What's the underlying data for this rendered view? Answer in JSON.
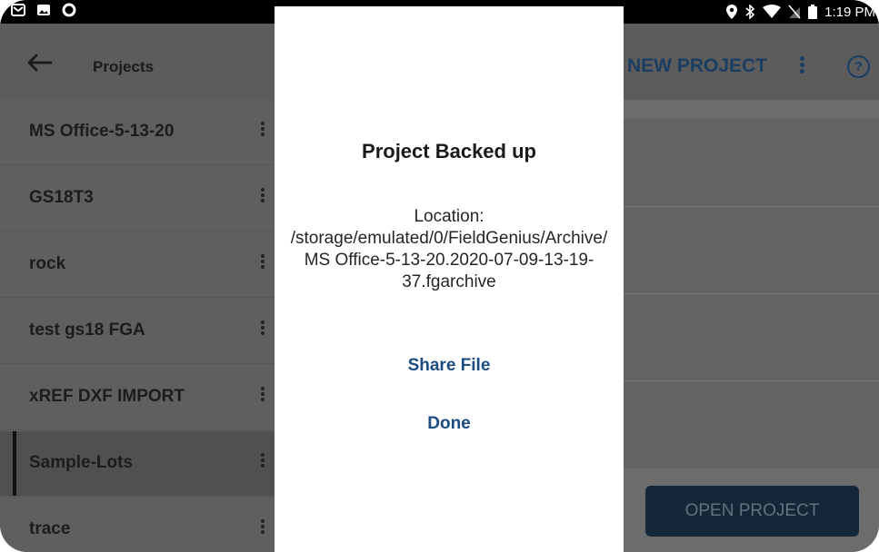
{
  "status_bar": {
    "time": "1:19 PM",
    "icons": [
      "mail-icon",
      "image-icon",
      "circle-icon",
      "location-icon",
      "bluetooth-icon",
      "wifi-icon",
      "no-sim-icon",
      "battery-icon"
    ]
  },
  "app_bar": {
    "title": "Projects",
    "new_project_label": "NEW PROJECT"
  },
  "projects": [
    {
      "name": "MS Office-5-13-20"
    },
    {
      "name": "GS18T3"
    },
    {
      "name": "rock"
    },
    {
      "name": "test gs18 FGA"
    },
    {
      "name": "xREF DXF IMPORT"
    },
    {
      "name": "Sample-Lots"
    },
    {
      "name": "trace"
    }
  ],
  "open_project_label": "OPEN PROJECT",
  "dialog": {
    "title": "Project Backed up",
    "message": "Location: /storage/emulated/0/FieldGenius/Archive/MS Office-5-13-20.2020-07-09-13-19-37.fgarchive",
    "share_label": "Share File",
    "done_label": "Done"
  },
  "colors": {
    "accent": "#1c4d82",
    "overlay_gray": "#5f5f5f"
  }
}
